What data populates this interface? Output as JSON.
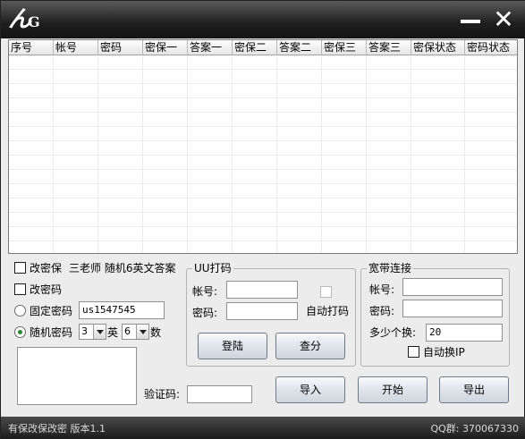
{
  "app": {
    "logo_text": "ん",
    "logo_sub": "G"
  },
  "window_controls": {
    "minimize_icon": "minimize-icon",
    "close_icon": "close-icon",
    "close_glyph": "✕"
  },
  "grid": {
    "columns": [
      "序号",
      "帐号",
      "密码",
      "密保一",
      "答案一",
      "密保二",
      "答案二",
      "密保三",
      "答案三",
      "密保状态",
      "密码状态"
    ],
    "rows": []
  },
  "options": {
    "change_security": {
      "label": "改密保",
      "checked": false
    },
    "security_template": "三老师 随机6英文答案",
    "change_password": {
      "label": "改密码",
      "checked": false
    },
    "fixed_password": {
      "label": "固定密码",
      "selected": false,
      "value": "us1547545"
    },
    "random_password": {
      "label": "随机密码",
      "selected": true,
      "letters_value": "3",
      "letters_label": "英",
      "digits_value": "6",
      "digits_label": "数"
    }
  },
  "captcha": {
    "label": "验证码:",
    "value": ""
  },
  "uu": {
    "title": "UU打码",
    "account_label": "帐号:",
    "account_value": "",
    "password_label": "密码:",
    "password_value": "",
    "auto_label": "自动打码",
    "auto_checked": false,
    "login_button": "登陆",
    "check_button": "查分"
  },
  "broadband": {
    "title": "宽带连接",
    "account_label": "帐号:",
    "account_value": "",
    "password_label": "密码:",
    "password_value": "",
    "count_label": "多少个换:",
    "count_value": "20",
    "auto_ip_label": "自动换IP",
    "auto_ip_checked": false
  },
  "actions": {
    "import_button": "导入",
    "start_button": "开始",
    "export_button": "导出"
  },
  "status": {
    "left": "有保改保改密 版本1.1",
    "right": "QQ群: 370067330"
  }
}
